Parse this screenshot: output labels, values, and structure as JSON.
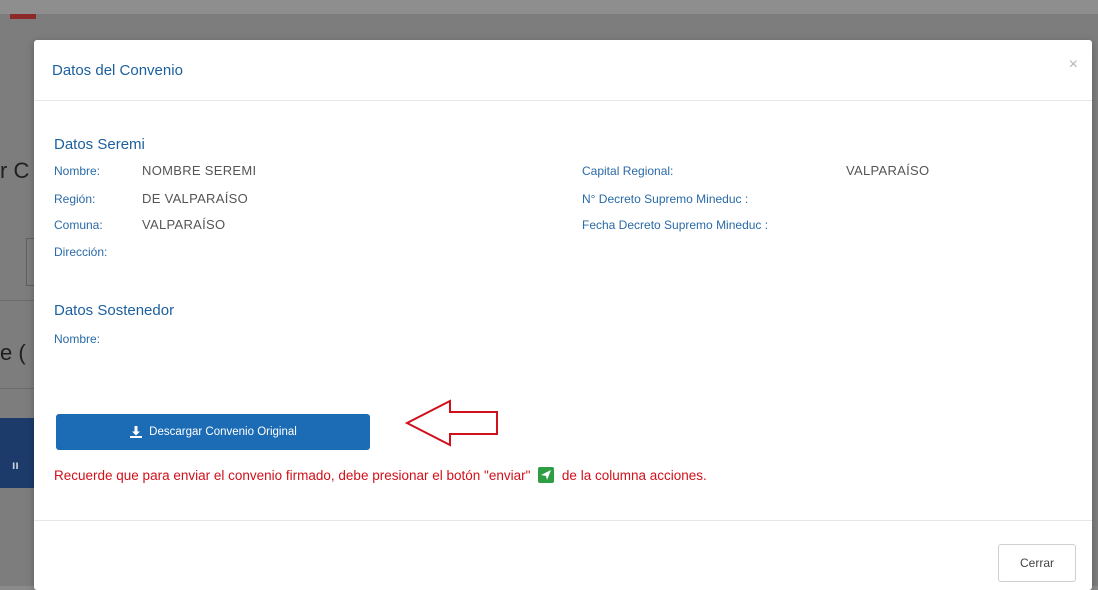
{
  "background": {
    "fragment_1": "r C",
    "fragment_2": "e (",
    "fragment_3": "ıı"
  },
  "modal": {
    "title": "Datos del Convenio",
    "close_glyph": "×"
  },
  "seremi": {
    "title": "Datos Seremi",
    "nombre_label": "Nombre:",
    "nombre_value": "NOMBRE SEREMI",
    "region_label": "Región:",
    "region_value": "DE VALPARAÍSO",
    "comuna_label": "Comuna:",
    "comuna_value": "VALPARAÍSO",
    "direccion_label": "Dirección:",
    "capital_label": "Capital Regional:",
    "capital_value": "VALPARAÍSO",
    "decreto_label": "N° Decreto Supremo Mineduc :",
    "fecha_label": "Fecha Decreto Supremo Mineduc :"
  },
  "sostenedor": {
    "title": "Datos Sostenedor",
    "nombre_label": "Nombre:"
  },
  "actions": {
    "download_label": "Descargar Convenio Original",
    "note_before": "Recuerde que para enviar el convenio firmado, debe presionar el botón \"enviar\"",
    "note_after": "de la columna acciones.",
    "close_label": "Cerrar"
  },
  "colors": {
    "accent": "#1c5f9e",
    "button": "#1b6bb5",
    "warning": "#d0101a",
    "send_icon": "#2e9e44"
  }
}
